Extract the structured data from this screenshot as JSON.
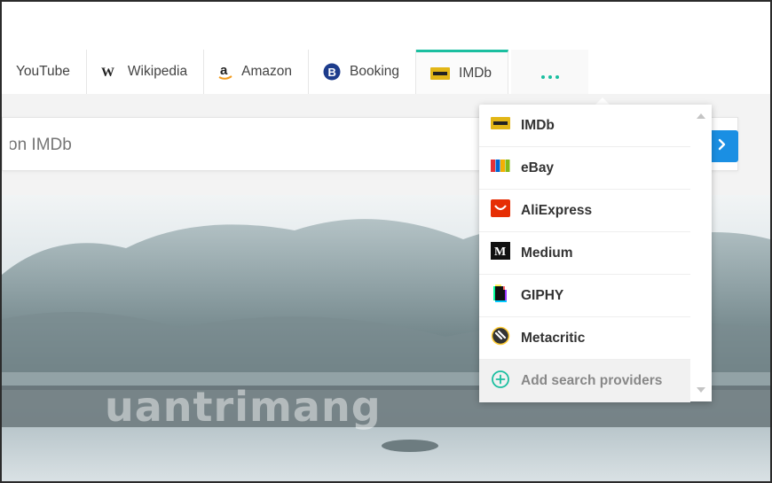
{
  "tabs": [
    {
      "label": "YouTube",
      "icon": "youtube-icon"
    },
    {
      "label": "Wikipedia",
      "icon": "wikipedia-icon"
    },
    {
      "label": "Amazon",
      "icon": "amazon-icon"
    },
    {
      "label": "Booking",
      "icon": "booking-icon"
    },
    {
      "label": "IMDb",
      "icon": "imdb-icon",
      "active": true
    }
  ],
  "more_icon": "more-dots-icon",
  "search": {
    "placeholder": "on IMDb"
  },
  "dropdown": {
    "items": [
      {
        "label": "IMDb",
        "icon": "imdb-icon"
      },
      {
        "label": "eBay",
        "icon": "ebay-icon"
      },
      {
        "label": "AliExpress",
        "icon": "aliexpress-icon"
      },
      {
        "label": "Medium",
        "icon": "medium-icon"
      },
      {
        "label": "GIPHY",
        "icon": "giphy-icon"
      },
      {
        "label": "Metacritic",
        "icon": "metacritic-icon"
      }
    ],
    "add_label": "Add search providers"
  },
  "watermark": "uantrimang",
  "colors": {
    "accent": "#1bbfa0",
    "go_button": "#1a8fe3",
    "imdb_yellow": "#e2b616"
  }
}
